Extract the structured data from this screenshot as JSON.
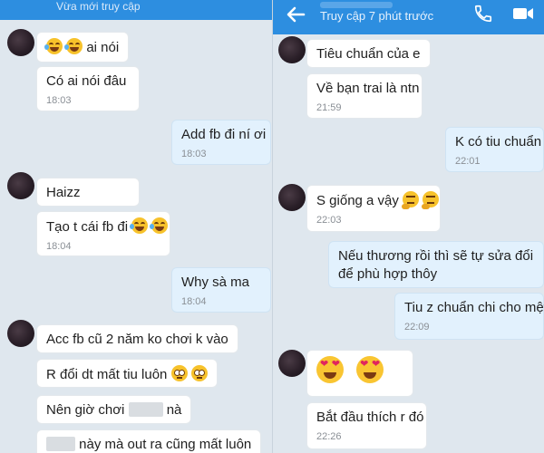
{
  "left": {
    "header": {
      "subtitle": "Vừa mới truy cập"
    },
    "messages": {
      "m1": {
        "text": "ai nói"
      },
      "m2": {
        "text": "Có ai nói đâu",
        "time": "18:03"
      },
      "m3": {
        "text": "Add fb đi ní ơi",
        "time": "18:03"
      },
      "m4": {
        "text": "Haizz"
      },
      "m5": {
        "text": "Tạo t cái fb đi",
        "time": "18:04"
      },
      "m6": {
        "text": "Why sà ma",
        "time": "18:04"
      },
      "m7": {
        "text": "Acc fb cũ 2 năm ko chơi k vào"
      },
      "m8": {
        "text": "R đổi dt mất tiu luôn"
      },
      "m9": {
        "text_before": "Nên giờ chơi",
        "text_after": "nà"
      },
      "m10": {
        "text": "này mà out ra cũng mất luôn"
      }
    }
  },
  "right": {
    "header": {
      "subtitle": "Truy cập 7 phút trước",
      "icons": [
        "back-arrow-icon",
        "phone-icon",
        "video-call-icon"
      ],
      "color": "#2d8ee0"
    },
    "messages": {
      "m1": {
        "text": "Tiêu chuẩn của e"
      },
      "m2": {
        "text": "Về bạn trai là ntn",
        "time": "21:59"
      },
      "m3": {
        "text": "K có tiu chuẩn",
        "time": "22:01"
      },
      "m4": {
        "text": "S giống a vậy",
        "time": "22:03"
      },
      "m5": {
        "text": "Nếu thương rồi thì sẽ tự sửa đổi để phù hợp thôy"
      },
      "m6": {
        "text": "Tiu z chuẩn chi cho mệt",
        "time": "22:09"
      },
      "m8": {
        "text": "Bắt đầu thích r đó",
        "time": "22:26"
      }
    }
  }
}
